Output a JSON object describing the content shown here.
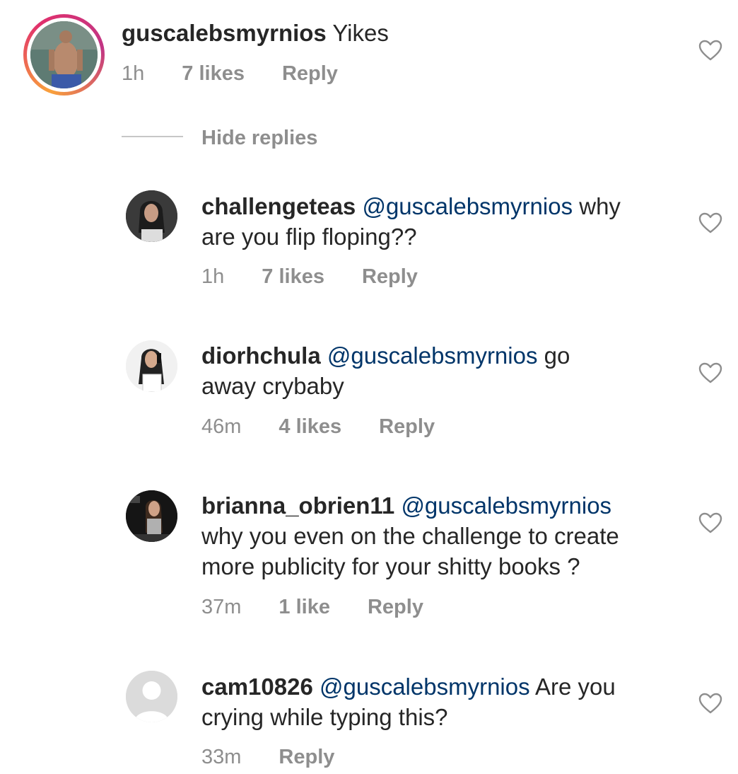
{
  "comment": {
    "username": "guscalebsmyrnios",
    "text": "Yikes",
    "time": "1h",
    "likes": "7 likes",
    "reply": "Reply"
  },
  "hide_replies": "Hide replies",
  "replies": [
    {
      "username": "challengeteas",
      "mention": "@guscalebsmyrnios",
      "text_line1_rest": "why",
      "text_line2": "are you flip floping??",
      "time": "1h",
      "likes": "7 likes",
      "reply": "Reply"
    },
    {
      "username": "diorhchula",
      "mention": "@guscalebsmyrnios",
      "text_line1_rest": "go",
      "text_line2": "away crybaby",
      "time": "46m",
      "likes": "4 likes",
      "reply": "Reply"
    },
    {
      "username": "brianna_obrien11",
      "mention": "@guscalebsmyrnios",
      "text_line2": "why you even on the challenge to create",
      "text_line3": "more publicity for your shitty books ?",
      "time": "37m",
      "likes": "1 like",
      "reply": "Reply"
    },
    {
      "username": "cam10826",
      "mention": "@guscalebsmyrnios",
      "text_line1_rest": "Are you",
      "text_line2": "crying while typing this?",
      "time": "33m",
      "reply": "Reply"
    }
  ],
  "icons": {
    "like": "heart-outline-icon"
  },
  "colors": {
    "text": "#262626",
    "mention": "#003569",
    "meta": "#8e8e8e"
  }
}
